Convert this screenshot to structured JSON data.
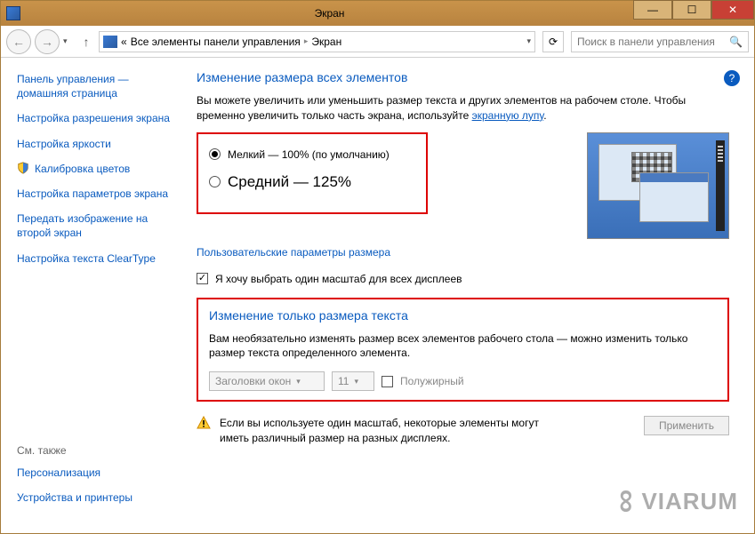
{
  "window": {
    "title": "Экран"
  },
  "nav": {
    "breadcrumb_prefix": "«",
    "breadcrumb1": "Все элементы панели управления",
    "breadcrumb2": "Экран",
    "search_placeholder": "Поиск в панели управления"
  },
  "sidebar": {
    "items": [
      "Панель управления — домашняя страница",
      "Настройка разрешения экрана",
      "Настройка яркости",
      "Калибровка цветов",
      "Настройка параметров экрана",
      "Передать изображение на второй экран",
      "Настройка текста ClearType"
    ],
    "see_also_head": "См. также",
    "see_also": [
      "Персонализация",
      "Устройства и принтеры"
    ]
  },
  "main": {
    "h1": "Изменение размера всех элементов",
    "desc_pre": "Вы можете увеличить или уменьшить размер текста и других элементов на рабочем столе. Чтобы временно увеличить только часть экрана, используйте ",
    "desc_link": "экранную лупу",
    "desc_post": ".",
    "radio_small": "Мелкий — 100% (по умолчанию)",
    "radio_medium": "Средний — 125%",
    "custom_link": "Пользовательские параметры размера",
    "chk_onescale": "Я хочу выбрать один масштаб для всех дисплеев",
    "h2": "Изменение только размера текста",
    "desc2": "Вам необязательно изменять размер всех элементов рабочего стола — можно изменить только размер текста определенного элемента.",
    "sel_item": "Заголовки окон",
    "sel_size": "11",
    "chk_bold": "Полужирный",
    "warn": "Если вы используете один масштаб, некоторые элементы могут иметь различный размер на разных дисплеях.",
    "apply": "Применить"
  },
  "watermark": "VIARUM"
}
